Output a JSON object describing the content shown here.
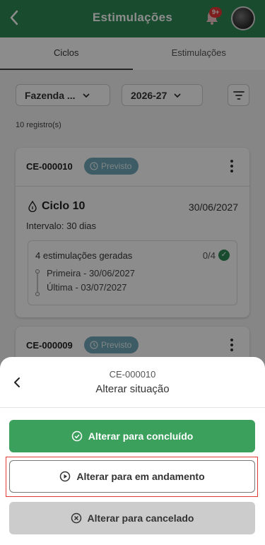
{
  "header": {
    "title": "Estimulações",
    "notification_badge": "9+",
    "brand_color": "#2e8b57"
  },
  "tabs": [
    {
      "label": "Ciclos",
      "active": true
    },
    {
      "label": "Estimulações",
      "active": false
    }
  ],
  "filters": {
    "farm": "Fazenda ...",
    "season": "2026-27"
  },
  "records_count": "10 registro(s)",
  "cards": [
    {
      "code": "CE-000010",
      "status": "Previsto",
      "cycle": "Ciclo 10",
      "date": "30/06/2027",
      "interval": "Intervalo: 30 dias",
      "stimulations": "4 estimulações geradas",
      "ratio": "0/4",
      "first": "Primeira - 30/06/2027",
      "last": "Última - 03/07/2027"
    },
    {
      "code": "CE-000009",
      "status": "Previsto"
    }
  ],
  "sheet": {
    "code": "CE-000010",
    "title": "Alterar situação",
    "actions": {
      "done": "Alterar para concluído",
      "in_progress": "Alterar para em andamento",
      "cancel": "Alterar para cancelado"
    }
  }
}
